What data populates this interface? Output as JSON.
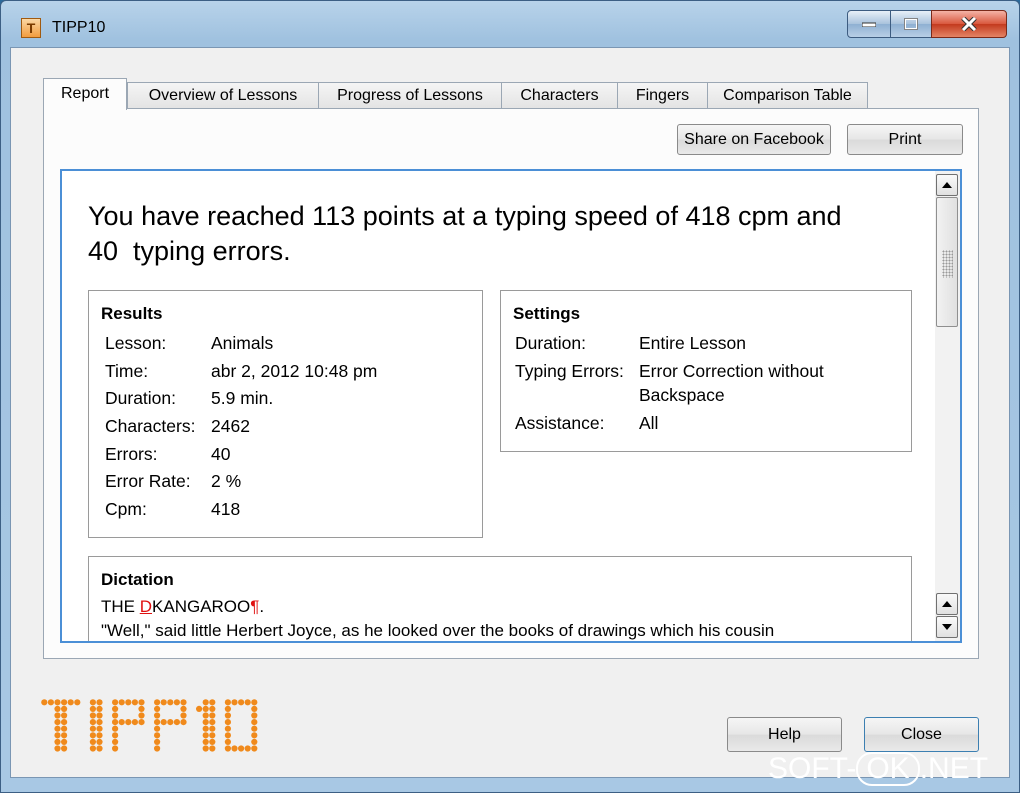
{
  "window": {
    "title": "TIPP10",
    "icon": "tipp10-app-icon"
  },
  "tabs": [
    {
      "label": "Report",
      "active": true
    },
    {
      "label": "Overview of Lessons"
    },
    {
      "label": "Progress of Lessons"
    },
    {
      "label": "Characters"
    },
    {
      "label": "Fingers"
    },
    {
      "label": "Comparison Table"
    }
  ],
  "toolbar": {
    "share_label": "Share on Facebook",
    "print_label": "Print"
  },
  "report": {
    "headline_line1": "You have reached 113 points at a typing speed of 418 cpm and",
    "headline_line2": "40  typing errors.",
    "results": {
      "title": "Results",
      "rows": [
        {
          "label": "Lesson:",
          "value": "Animals"
        },
        {
          "label": "Time:",
          "value": "abr 2, 2012 10:48 pm"
        },
        {
          "label": "Duration:",
          "value": "5.9 min."
        },
        {
          "label": "Characters:",
          "value": "2462"
        },
        {
          "label": "Errors:",
          "value": "40"
        },
        {
          "label": "Error Rate:",
          "value": "2 %"
        },
        {
          "label": "Cpm:",
          "value": "418"
        }
      ]
    },
    "settings": {
      "title": "Settings",
      "rows": [
        {
          "label": "Duration:",
          "value": "Entire Lesson"
        },
        {
          "label": "Typing Errors:",
          "value": "Error Correction without",
          "value2": "Backspace"
        },
        {
          "label": "Assistance:",
          "value": "All"
        }
      ]
    },
    "dictation": {
      "title": "Dictation",
      "line1_pre": "THE ",
      "line1_error": "D",
      "line1_post": "KANGAROO",
      "line1_mark": "¶",
      "line1_end": ".",
      "line2": "\"Well,\" said little Herbert Joyce, as he looked over the books of drawings which his cousin",
      "error_color": "#e01010"
    }
  },
  "footer": {
    "logo_text": "TIPP10",
    "logo_color": "#f08a1c",
    "help_label": "Help",
    "close_label": "Close"
  },
  "watermark": {
    "part1": "SOFT-",
    "part2": "OK",
    "part3": ".NET"
  }
}
